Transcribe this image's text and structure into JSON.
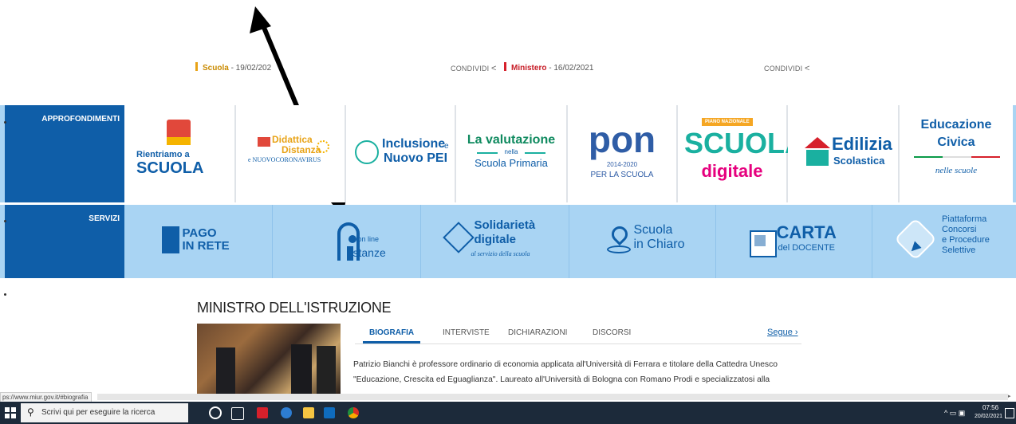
{
  "news": [
    {
      "category": "Scuola",
      "date": " - 19/02/202",
      "color": "#e8a317"
    },
    {
      "category": "Ministero",
      "date": " - 16/02/2021",
      "color": "#d6202b"
    }
  ],
  "share_label": "CONDIVIDI",
  "approfondimenti": {
    "label": "APPROFONDIMENTI",
    "cards": [
      {
        "line1": "Rientriamo a",
        "line2": "SCUOLA"
      },
      {
        "line1": "Didattica",
        "line2": "Distanza",
        "line3": "e NUOVOCORONAVIRUS"
      },
      {
        "line1": "Inclusione",
        "line1b": "e",
        "line2": "Nuovo PEI"
      },
      {
        "line1": "La valutazione",
        "line2": "nella",
        "line3": "Scuola Primaria"
      },
      {
        "line1": "pon",
        "line2": "2014-2020",
        "line3": "PER LA SCUOLA"
      },
      {
        "line1": "PIANO NAZIONALE",
        "line2": "SCUOLA",
        "line3": "digitale"
      },
      {
        "line1": "Edilizia",
        "line2": "Scolastica"
      },
      {
        "line1": "Educazione",
        "line2": "Civica",
        "line3": "nelle scuole"
      }
    ]
  },
  "servizi": {
    "label": "SERVIZI",
    "cards": [
      {
        "line1": "PAGO",
        "line2": "IN RETE"
      },
      {
        "line1": "on line",
        "line2": "stanze"
      },
      {
        "line1": "Solidarietà",
        "line2": "digitale",
        "line3": "al servizio della scuola"
      },
      {
        "line1": "Scuola",
        "line2": "in Chiaro"
      },
      {
        "line1": "CARTA",
        "line2": "del DOCENTE"
      },
      {
        "line1": "Piattaforma",
        "line2": "Concorsi",
        "line3": "e Procedure",
        "line4": "Selettive"
      }
    ]
  },
  "ministro": {
    "title": "MINISTRO DELL'ISTRUZIONE",
    "tabs": [
      "BIOGRAFIA",
      "INTERVISTE",
      "DICHIARAZIONI",
      "DISCORSI"
    ],
    "segue": "Segue ›",
    "bio_line1": "Patrizio Bianchi è professore ordinario di economia applicata all'Università di Ferrara e titolare della Cattedra Unesco",
    "bio_line2": "\"Educazione, Crescita ed Eguaglianza\". Laureato all'Università di Bologna con Romano Prodi e specializzatosi alla"
  },
  "statusbar_url": "ps://www.miur.gov.it/#biografia",
  "taskbar": {
    "search_placeholder": "Scrivi qui per eseguire la ricerca",
    "time": "07:56",
    "date": "20/02/2021"
  }
}
